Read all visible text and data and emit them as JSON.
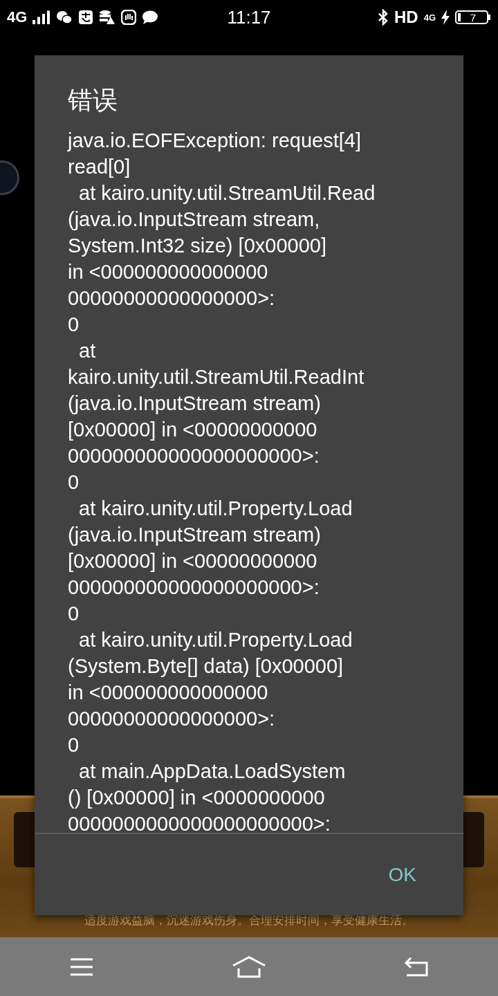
{
  "status_bar": {
    "network": "4G",
    "time": "11:17",
    "hd": "HD",
    "network_small": "4G",
    "battery": "7"
  },
  "background": {
    "notice": "适度游戏益脑，沉迷游戏伤身。合理安排时间，享受健康生活。"
  },
  "dialog": {
    "title": "错误",
    "message": "java.io.EOFException: request[4]\nread[0]\n  at kairo.unity.util.StreamUtil.Read\n(java.io.InputStream stream,\nSystem.Int32 size) [0x00000]\nin <000000000000000\n00000000000000000>:\n0\n  at\nkairo.unity.util.StreamUtil.ReadInt\n(java.io.InputStream stream)\n[0x00000] in <00000000000\n000000000000000000000>:\n0\n  at kairo.unity.util.Property.Load\n(java.io.InputStream stream)\n[0x00000] in <00000000000\n000000000000000000000>:\n0\n  at kairo.unity.util.Property.Load\n(System.Byte[] data) [0x00000]\nin <000000000000000\n00000000000000000>:\n0\n  at main.AppData.LoadSystem\n() [0x00000] in <0000000000\n0000000000000000000000>:",
    "buttons": [
      "OK"
    ]
  }
}
